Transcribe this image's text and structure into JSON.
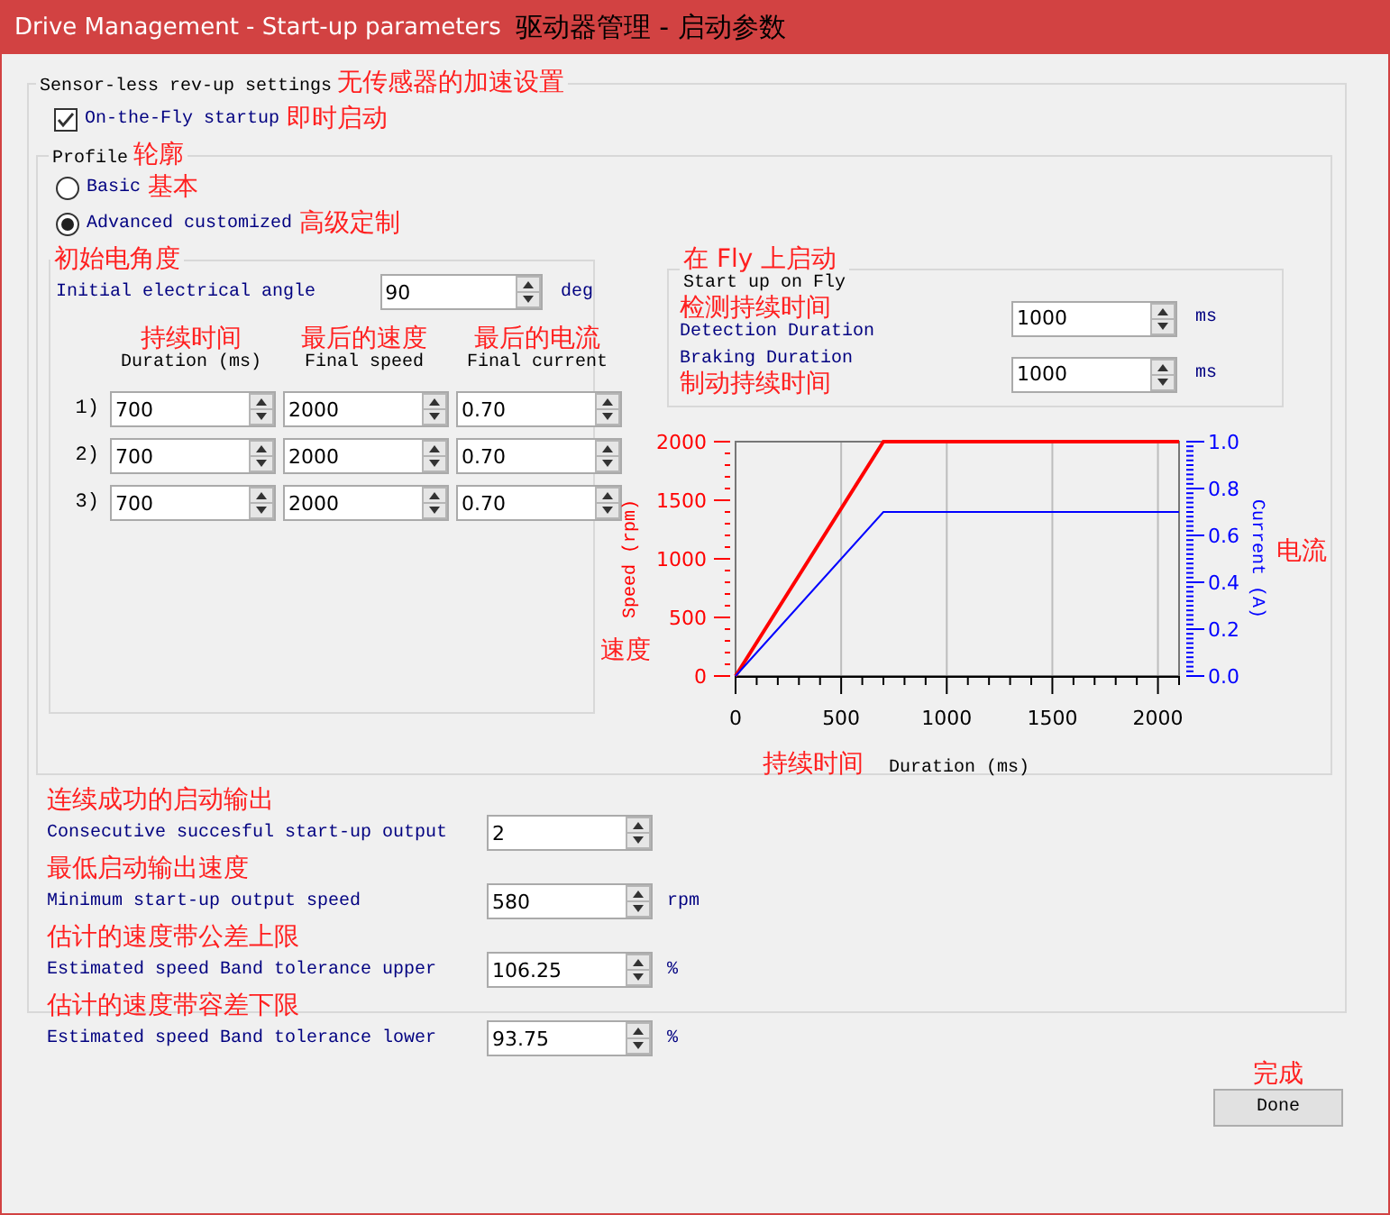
{
  "window": {
    "title": "Drive Management - Start-up parameters",
    "note": "驱动器管理 - 启动参数"
  },
  "sensorless": {
    "title": "Sensor-less rev-up settings",
    "note": "无传感器的加速设置",
    "on_the_fly": {
      "label": "On-the-Fly startup",
      "note": "即时启动",
      "checked": true
    },
    "profile": {
      "title": "Profile",
      "note": "轮廓",
      "options": [
        {
          "label": "Basic",
          "note": "基本",
          "selected": false
        },
        {
          "label": "Advanced customized",
          "note": "高级定制",
          "selected": true
        }
      ],
      "advanced": {
        "note": "初始电角度",
        "angle": {
          "label": "Initial electrical angle",
          "value": "90",
          "unit": "deg"
        },
        "columns": [
          {
            "note": "持续时间",
            "label": "Duration (ms)"
          },
          {
            "note": "最后的速度",
            "label": "Final speed"
          },
          {
            "note": "最后的电流",
            "label": "Final current"
          }
        ],
        "rows": [
          {
            "index": "1)",
            "values": [
              "700",
              "2000",
              "0.70"
            ]
          },
          {
            "index": "2)",
            "values": [
              "700",
              "2000",
              "0.70"
            ]
          },
          {
            "index": "3)",
            "values": [
              "700",
              "2000",
              "0.70"
            ]
          }
        ]
      },
      "fly": {
        "note": "在 Fly 上启动",
        "title": "Start up on Fly",
        "fields": [
          {
            "label": "Detection Duration",
            "note": "检测持续时间",
            "value": "1000",
            "unit": "ms"
          },
          {
            "label": "Braking Duration",
            "note": "制动持续时间",
            "value": "1000",
            "unit": "ms"
          }
        ]
      },
      "chart": {
        "notes": {
          "y": "速度",
          "y2": "电流",
          "x": "持续时间"
        },
        "chart_data": {
          "type": "line",
          "xlabel": "Duration (ms)",
          "ylabel": "Speed (rpm)",
          "y2label": "Current (A)",
          "x": [
            0,
            700,
            2100
          ],
          "series": [
            {
              "color": "#ff0000",
              "axis": "y",
              "values": [
                0,
                2000,
                2000
              ]
            },
            {
              "color": "#0000ff",
              "axis": "y2",
              "values": [
                0,
                0.7,
                0.7
              ]
            }
          ],
          "grid": true,
          "xlim": [
            0,
            2100
          ],
          "ylim": [
            0,
            2000
          ],
          "y2lim": [
            0,
            1
          ],
          "xticks": [
            0,
            500,
            1000,
            1500,
            2000
          ],
          "yticks": [
            0,
            500,
            1000,
            1500,
            2000
          ],
          "y2ticks": [
            {
              "value": 0,
              "label": "0.0"
            },
            {
              "value": 0.2,
              "label": "0.2"
            },
            {
              "value": 0.4,
              "label": "0.4"
            },
            {
              "value": 0.6,
              "label": "0.6"
            },
            {
              "value": 0.8,
              "label": "0.8"
            },
            {
              "value": 1,
              "label": "1.0"
            }
          ]
        }
      }
    },
    "outputs": [
      {
        "note": "连续成功的启动输出",
        "label": "Consecutive succesful start-up output",
        "value": "2"
      },
      {
        "note": "最低启动输出速度",
        "label": "Minimum start-up output speed",
        "value": "580",
        "unit": "rpm"
      },
      {
        "note": "估计的速度带公差上限",
        "label": "Estimated speed Band tolerance upper",
        "value": "106.25",
        "unit": "%"
      },
      {
        "note": "估计的速度带容差下限",
        "label": "Estimated speed Band tolerance lower",
        "value": "93.75",
        "unit": "%"
      }
    ]
  },
  "buttons": [
    {
      "label": "Done",
      "note": "完成"
    }
  ]
}
